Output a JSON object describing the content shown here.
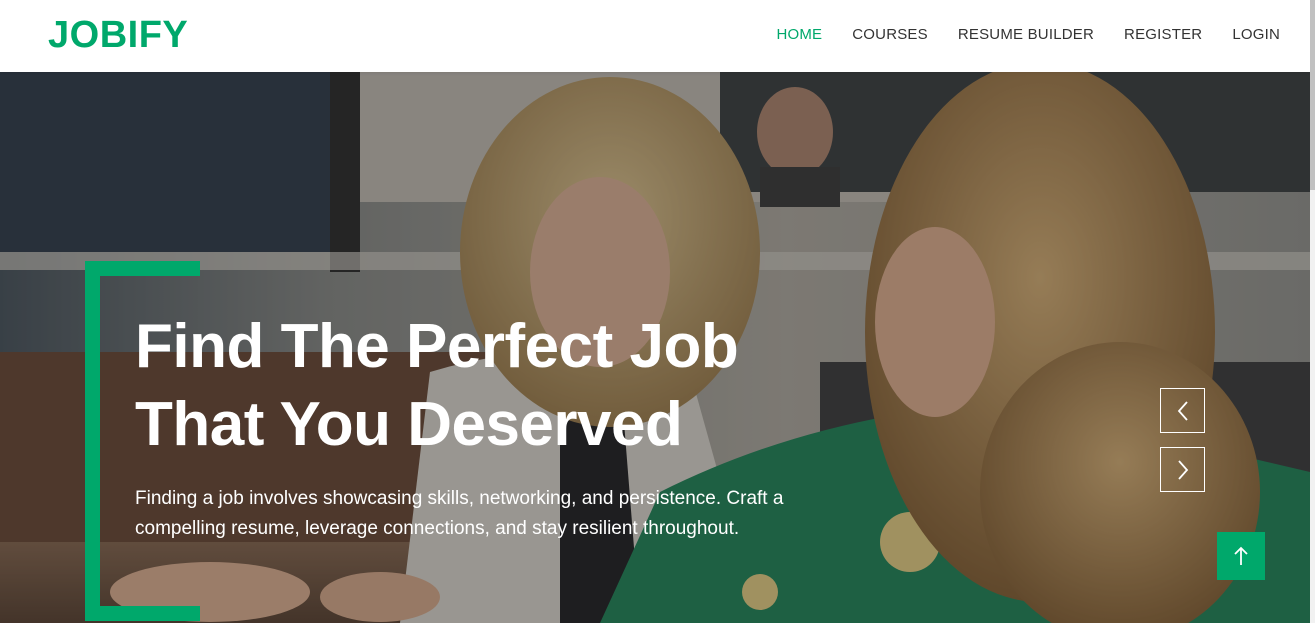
{
  "brand": {
    "name": "JOBIFY",
    "color": "#00a86b"
  },
  "nav": {
    "items": [
      {
        "label": "HOME",
        "active": true
      },
      {
        "label": "COURSES",
        "active": false
      },
      {
        "label": "RESUME BUILDER",
        "active": false
      },
      {
        "label": "REGISTER",
        "active": false
      },
      {
        "label": "LOGIN",
        "active": false
      }
    ]
  },
  "hero": {
    "title_line1": "Find The Perfect Job",
    "title_line2": "That You Deserved",
    "description": "Finding a job involves showcasing skills, networking, and persistence. Craft a compelling resume, leverage connections, and stay resilient throughout.",
    "accent_color": "#00a86b",
    "background_image": "photo of two women working together at a table"
  },
  "controls": {
    "prev_icon": "chevron-left-icon",
    "next_icon": "chevron-right-icon",
    "to_top_icon": "arrow-up-icon"
  }
}
